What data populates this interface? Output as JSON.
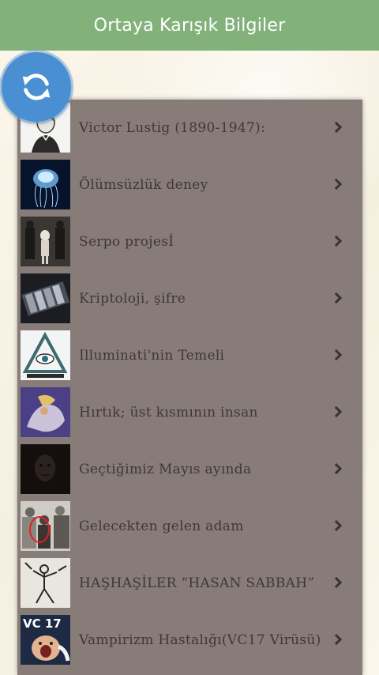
{
  "header": {
    "title": "Ortaya Karışık Bilgiler"
  },
  "refresh": {
    "icon": "refresh-icon",
    "color": "#4b8fd3"
  },
  "list": {
    "items": [
      {
        "title": "Victor Lustig (1890-1947):",
        "thumb": "portrait-sketch"
      },
      {
        "title": "Ölümsüzlük deney",
        "thumb": "jellyfish"
      },
      {
        "title": "Serpo projesİ",
        "thumb": "alien-figures"
      },
      {
        "title": "Kriptoloji, şifre",
        "thumb": "cipher-dials"
      },
      {
        "title": "Illuminati'nin Temeli",
        "thumb": "illuminati-eye"
      },
      {
        "title": "Hırtık; üst kısmının insan",
        "thumb": "creature-painting"
      },
      {
        "title": "Geçtiğimiz Mayıs ayında",
        "thumb": "dark-face"
      },
      {
        "title": "Gelecekten gelen adam",
        "thumb": "crowd-photo"
      },
      {
        "title": "HAŞHAŞİLER “HASAN SABBAH”",
        "thumb": "assassin-drawing"
      },
      {
        "title": "Vampirizm Hastalığı(VC17 Virüsü)",
        "thumb": "vc17-screaming"
      }
    ]
  },
  "colors": {
    "header": "#82b27a",
    "panel": "#877c78",
    "text": "#3f3835"
  }
}
